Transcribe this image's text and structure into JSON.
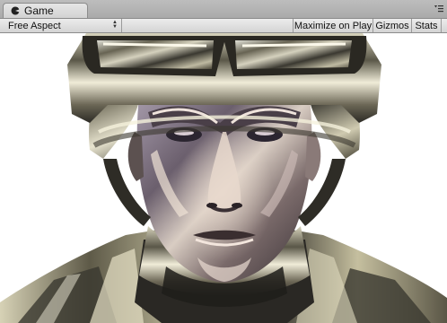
{
  "window": {
    "tab_title": "Game",
    "tab_icon": "pac-game-icon",
    "menu_icon": "panel-menu-icon"
  },
  "toolbar": {
    "aspect_label": "Free Aspect",
    "maximize_label": "Maximize on Play",
    "gizmos_label": "Gizmos",
    "stats_label": "Stats"
  },
  "viewport": {
    "background": "#ffffff",
    "content": "chrome soldier head render"
  }
}
